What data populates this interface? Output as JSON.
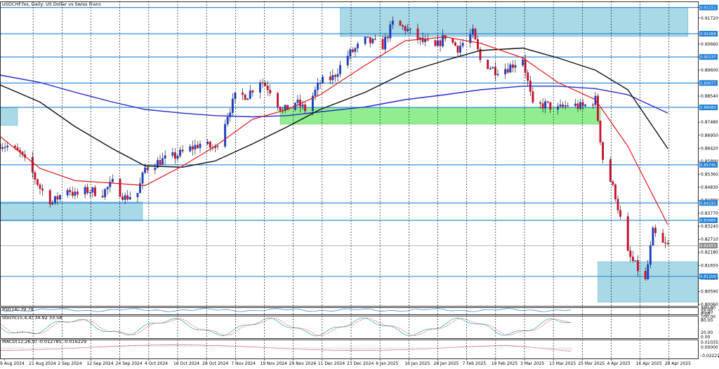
{
  "title": "USDCHF.fxs, Daily:  US Dollar vs Swiss Franc",
  "colors": {
    "bull": "#1c3fc2",
    "bear": "#c8102e",
    "ma_fast": "#e0161a",
    "ma_slow": "#111111",
    "ma_long": "#2a2ad4",
    "level": "#1f7fd6",
    "zone_blue": "#a9d8e6",
    "zone_green": "#90ee90",
    "grid": "#000000"
  },
  "price_axis": {
    "ticks": [
      "0.92151",
      "0.91720",
      "0.91084",
      "0.90660",
      "0.90137",
      "0.89600",
      "0.89077",
      "0.88540",
      "0.88083",
      "0.87480",
      "0.86950",
      "0.86420",
      "0.85890",
      "0.85360",
      "0.84830",
      "0.84300",
      "0.83770",
      "0.83240",
      "0.82710",
      "0.82180",
      "0.81650",
      "0.81120",
      "0.80590",
      "0.80060"
    ],
    "highlighted": [
      "0.92151",
      "0.91084",
      "0.90137",
      "0.89077",
      "0.88083",
      "0.85745",
      "0.84191",
      "0.83485",
      "0.82453",
      "0.81200"
    ],
    "current": "0.82453"
  },
  "date_axis": [
    "9 Aug 2024",
    "21 Aug 2024",
    "2 Sep 2024",
    "12 Sep 2024",
    "24 Sep 2024",
    "4 Oct 2024",
    "16 Oct 2024",
    "28 Oct 2024",
    "7 Nov 2024",
    "19 Nov 2024",
    "29 Nov 2024",
    "11 Dec 2024",
    "23 Dec 2024",
    "6 Jan 2025",
    "16 Jan 2025",
    "28 Jan 2025",
    "7 Feb 2025",
    "19 Feb 2025",
    "3 Mar 2025",
    "13 Mar 2025",
    "25 Mar 2025",
    "4 Apr 2025",
    "16 Apr 2025",
    "28 Apr 2025"
  ],
  "rsi": {
    "label": "RSI(14) 39.79",
    "ticks": [
      "100.00",
      "70.00",
      "30.00",
      "0.00"
    ]
  },
  "stoch": {
    "label": "Stoch(15,4,4) 34.92 33.58",
    "ticks": [
      "80.00",
      "20.00",
      "0.00"
    ],
    "ticks_top": "100.00"
  },
  "macd": {
    "label": "MACD(12,26,9) -0.012785 -0.016229",
    "ticks": [
      "0.010351",
      "0.00000",
      "-0.022210"
    ]
  },
  "chart_data": {
    "type": "candlestick",
    "instrument": "USDCHF",
    "timeframe": "Daily",
    "y_range": [
      0.8,
      0.924
    ],
    "levels": [
      0.92151,
      0.91084,
      0.90137,
      0.89077,
      0.88083,
      0.85745,
      0.84191,
      0.83485,
      0.812
    ],
    "zones": [
      {
        "color": "blue",
        "from": "2024-08-06",
        "to": "2024-08-13",
        "low": 0.8735,
        "high": 0.8807
      },
      {
        "color": "blue",
        "from": "2024-08-06",
        "to": "2024-10-02",
        "low": 0.8346,
        "high": 0.8423
      },
      {
        "color": "blue",
        "from": "2024-12-20",
        "to": "2025-05-08",
        "low": 0.9097,
        "high": 0.9215
      },
      {
        "color": "green",
        "from": "2024-11-26",
        "to": "2025-04-03",
        "low": 0.874,
        "high": 0.8808
      },
      {
        "color": "blue",
        "from": "2025-04-02",
        "to": "2025-05-12",
        "low": 0.8015,
        "high": 0.818
      }
    ],
    "price_path": [
      [
        "2024-08-06",
        0.866
      ],
      [
        "2024-08-09",
        0.865
      ],
      [
        "2024-08-14",
        0.862
      ],
      [
        "2024-08-19",
        0.854
      ],
      [
        "2024-08-22",
        0.848
      ],
      [
        "2024-08-27",
        0.842
      ],
      [
        "2024-09-02",
        0.848
      ],
      [
        "2024-09-05",
        0.845
      ],
      [
        "2024-09-10",
        0.847
      ],
      [
        "2024-09-16",
        0.846
      ],
      [
        "2024-09-20",
        0.85
      ],
      [
        "2024-09-25",
        0.844
      ],
      [
        "2024-09-30",
        0.846
      ],
      [
        "2024-10-03",
        0.856
      ],
      [
        "2024-10-09",
        0.859
      ],
      [
        "2024-10-15",
        0.861
      ],
      [
        "2024-10-21",
        0.864
      ],
      [
        "2024-10-25",
        0.866
      ],
      [
        "2024-10-31",
        0.864
      ],
      [
        "2024-11-05",
        0.878
      ],
      [
        "2024-11-08",
        0.885
      ],
      [
        "2024-11-13",
        0.886
      ],
      [
        "2024-11-18",
        0.892
      ],
      [
        "2024-11-22",
        0.888
      ],
      [
        "2024-11-27",
        0.879
      ],
      [
        "2024-12-02",
        0.883
      ],
      [
        "2024-12-06",
        0.88
      ],
      [
        "2024-12-12",
        0.891
      ],
      [
        "2024-12-17",
        0.893
      ],
      [
        "2024-12-23",
        0.902
      ],
      [
        "2024-12-30",
        0.908
      ],
      [
        "2025-01-06",
        0.906
      ],
      [
        "2025-01-10",
        0.915
      ],
      [
        "2025-01-15",
        0.913
      ],
      [
        "2025-01-21",
        0.908
      ],
      [
        "2025-01-27",
        0.905
      ],
      [
        "2025-01-31",
        0.91
      ],
      [
        "2025-02-05",
        0.905
      ],
      [
        "2025-02-11",
        0.911
      ],
      [
        "2025-02-14",
        0.9
      ],
      [
        "2025-02-20",
        0.896
      ],
      [
        "2025-02-25",
        0.897
      ],
      [
        "2025-03-03",
        0.901
      ],
      [
        "2025-03-07",
        0.881
      ],
      [
        "2025-03-12",
        0.882
      ],
      [
        "2025-03-17",
        0.88
      ],
      [
        "2025-03-21",
        0.882
      ],
      [
        "2025-03-27",
        0.881
      ],
      [
        "2025-04-01",
        0.884
      ],
      [
        "2025-04-04",
        0.86
      ],
      [
        "2025-04-09",
        0.845
      ],
      [
        "2025-04-14",
        0.821
      ],
      [
        "2025-04-18",
        0.815
      ],
      [
        "2025-04-21",
        0.81
      ],
      [
        "2025-04-24",
        0.83
      ],
      [
        "2025-04-28",
        0.825
      ],
      [
        "2025-04-30",
        0.8245
      ]
    ],
    "ma_fast": [
      [
        "2024-08-06",
        0.869
      ],
      [
        "2024-08-22",
        0.856
      ],
      [
        "2024-09-05",
        0.851
      ],
      [
        "2024-09-20",
        0.85
      ],
      [
        "2024-10-03",
        0.849
      ],
      [
        "2024-10-18",
        0.857
      ],
      [
        "2024-10-31",
        0.865
      ],
      [
        "2024-11-15",
        0.876
      ],
      [
        "2024-11-29",
        0.88
      ],
      [
        "2024-12-12",
        0.886
      ],
      [
        "2024-12-30",
        0.898
      ],
      [
        "2025-01-15",
        0.908
      ],
      [
        "2025-01-31",
        0.9095
      ],
      [
        "2025-02-14",
        0.907
      ],
      [
        "2025-03-03",
        0.901
      ],
      [
        "2025-03-17",
        0.891
      ],
      [
        "2025-04-01",
        0.884
      ],
      [
        "2025-04-14",
        0.865
      ],
      [
        "2025-04-30",
        0.833
      ]
    ],
    "ma_slow": [
      [
        "2024-08-06",
        0.89
      ],
      [
        "2024-08-22",
        0.883
      ],
      [
        "2024-09-05",
        0.873
      ],
      [
        "2024-09-20",
        0.864
      ],
      [
        "2024-10-03",
        0.857
      ],
      [
        "2024-10-18",
        0.8565
      ],
      [
        "2024-10-31",
        0.859
      ],
      [
        "2024-11-15",
        0.866
      ],
      [
        "2024-11-29",
        0.873
      ],
      [
        "2024-12-12",
        0.88
      ],
      [
        "2024-12-30",
        0.887
      ],
      [
        "2025-01-15",
        0.895
      ],
      [
        "2025-01-31",
        0.9
      ],
      [
        "2025-02-14",
        0.904
      ],
      [
        "2025-03-03",
        0.905
      ],
      [
        "2025-03-17",
        0.901
      ],
      [
        "2025-04-01",
        0.896
      ],
      [
        "2025-04-14",
        0.888
      ],
      [
        "2025-04-30",
        0.864
      ]
    ],
    "ma_long": [
      [
        "2024-08-06",
        0.894
      ],
      [
        "2024-08-22",
        0.891
      ],
      [
        "2024-09-05",
        0.887
      ],
      [
        "2024-09-20",
        0.883
      ],
      [
        "2024-10-03",
        0.88
      ],
      [
        "2024-10-18",
        0.8785
      ],
      [
        "2024-10-31",
        0.8775
      ],
      [
        "2024-11-15",
        0.877
      ],
      [
        "2024-11-29",
        0.8775
      ],
      [
        "2024-12-12",
        0.879
      ],
      [
        "2024-12-30",
        0.881
      ],
      [
        "2025-01-15",
        0.884
      ],
      [
        "2025-01-31",
        0.886
      ],
      [
        "2025-02-14",
        0.888
      ],
      [
        "2025-03-03",
        0.8895
      ],
      [
        "2025-03-17",
        0.8895
      ],
      [
        "2025-04-01",
        0.8885
      ],
      [
        "2025-04-14",
        0.886
      ],
      [
        "2025-04-30",
        0.8785
      ]
    ]
  }
}
